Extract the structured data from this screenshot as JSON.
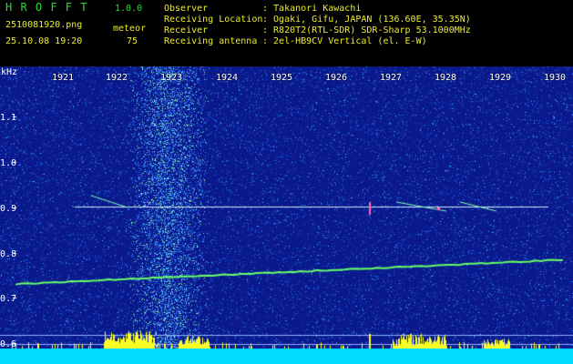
{
  "header": {
    "app_name": "H R O F F T",
    "version": "1.0.0",
    "filename": "2510081920.png",
    "datetime": "25.10.08 19:20",
    "meteor_label": "meteor",
    "meteor_count": "75",
    "observer_label": "Observer",
    "observer_value": ": Takanori Kawachi",
    "location_label": "Receiving Location",
    "location_value": ": Ogaki, Gifu, JAPAN (136.60E, 35.35N)",
    "receiver_label": "Receiver",
    "receiver_value": ": R820T2(RTL-SDR) SDR-Sharp 53.1000MHz",
    "antenna_label": "Receiving antenna",
    "antenna_value": ": 2el-HB9CV Vertical (el. E-W)"
  },
  "axis": {
    "unit": "kHz",
    "time_ticks": [
      "1921",
      "1922",
      "1923",
      "1924",
      "1925",
      "1926",
      "1927",
      "1928",
      "1929",
      "1930"
    ],
    "freq_ticks": [
      "1.1",
      "1.0",
      "0.9",
      "0.8",
      "0.7",
      "0.6"
    ]
  },
  "colors": {
    "background": "#0a1a8c",
    "noise_dense": "#2a7aff",
    "trace": "#66ff66",
    "carrier": "#cfe8ff",
    "bars": "#ffff22",
    "baseline": "#00ddff"
  }
}
